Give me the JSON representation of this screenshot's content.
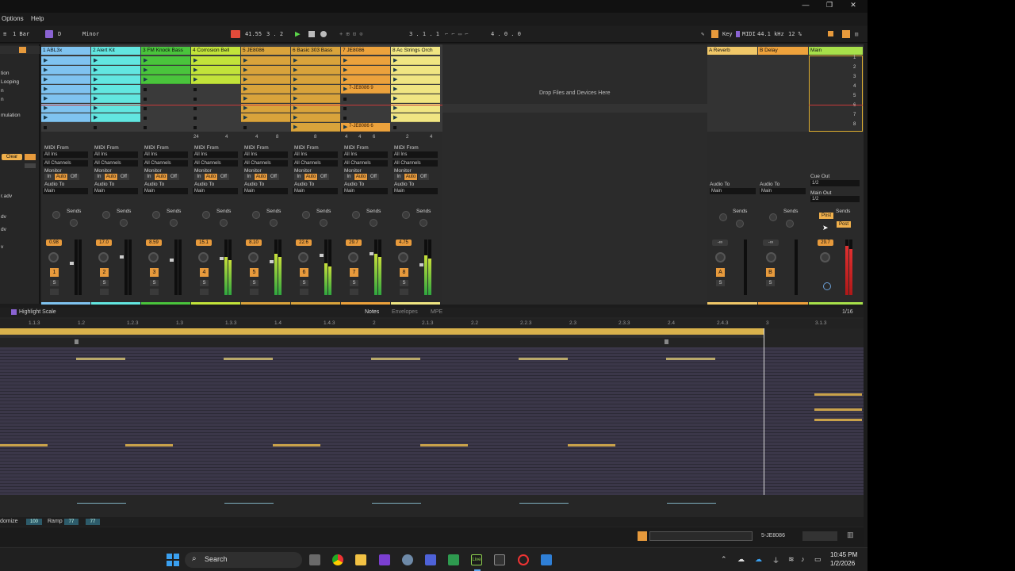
{
  "window": {
    "minimize": "—",
    "maximize": "❐",
    "close": "✕"
  },
  "menu": {
    "options": "Options",
    "help": "Help"
  },
  "control_bar": {
    "quantize": "1 Bar",
    "key_badge": "D",
    "scale": "Minor",
    "tempo": "41.55",
    "tempo_frac": "3 . 2",
    "pos_a": "3 . 1 . 1",
    "pos_b": "4 . 0 . 0",
    "key_label": "Key",
    "midi_label": "MIDI",
    "sample_rate": "44.1 kHz",
    "cpu": "12 %"
  },
  "left_panel": {
    "items": [
      "tion",
      "Looping",
      "n",
      "n",
      "mulation",
      "Clear",
      "r.adv",
      "dv",
      "dv",
      "v"
    ]
  },
  "tracks": [
    {
      "label": "1 ABL3x",
      "color": "#7fc3f0",
      "vol": "0.98",
      "num": "1"
    },
    {
      "label": "2 Alert Kit",
      "color": "#62e6e0",
      "vol": "17.0",
      "num": "2"
    },
    {
      "label": "3 FM Knock Bass",
      "color": "#4ac43c",
      "vol": "8.59",
      "num": "3"
    },
    {
      "label": "4 Corrosion Bell",
      "color": "#c2e33a",
      "vol": "15.1",
      "num": "4"
    },
    {
      "label": "5 JE8086",
      "color": "#d9a33b",
      "vol": "8.10",
      "num": "5"
    },
    {
      "label": "6 Basic 303 Bass",
      "color": "#d9a33b",
      "vol": "22.6",
      "num": "6"
    },
    {
      "label": "7 JE8086",
      "color": "#eca23c",
      "vol": "29.7",
      "num": "7"
    },
    {
      "label": "8 Ac Strings Orch",
      "color": "#f0e582",
      "vol": "4.75",
      "num": "8"
    }
  ],
  "returns": [
    {
      "label": "A Reverb",
      "color": "#f0c768",
      "num": "A",
      "vol": "-∞"
    },
    {
      "label": "B Delay",
      "color": "#eea23c",
      "num": "B",
      "vol": "-∞"
    },
    {
      "label": "Main",
      "color": "#a7e04a",
      "vol": "29.7"
    }
  ],
  "clips": {
    "je_a": "7-JE8086 9",
    "je_b": "7-JE8086 6"
  },
  "drop_text": "Drop Files and Devices Here",
  "io": {
    "midi_from": "MIDI From",
    "all_ins": "All Ins",
    "all_channels": "All Channels",
    "monitor": "Monitor",
    "in": "In",
    "auto": "Auto",
    "off": "Off",
    "audio_to": "Audio To",
    "main": "Main",
    "sends": "Sends",
    "cue_out": "Cue Out",
    "cue_val": "1/2",
    "main_out": "Main Out",
    "main_val": "1/2",
    "post": "Post",
    "s": "S",
    "a": "A",
    "b": "B",
    "scale_marks": [
      "0",
      "6",
      "12",
      "18",
      "24",
      "36",
      "48",
      "60"
    ]
  },
  "slot_counts": [
    "24",
    "4",
    "4",
    "8",
    "8",
    "4",
    "4",
    "6",
    "2",
    "4"
  ],
  "detail": {
    "highlight": "Highlight Scale",
    "tab_notes": "Notes",
    "tab_env": "Envelopes",
    "tab_mpe": "MPE",
    "grid": "1/16",
    "ticks": [
      "1.1.3",
      "1.2",
      "1.2.3",
      "1.3",
      "1.3.3",
      "1.4",
      "1.4.3",
      "2",
      "2.1.3",
      "2.2",
      "2.2.3",
      "2.3",
      "2.3.3",
      "2.4",
      "2.4.3",
      "3",
      "3.1.3"
    ],
    "randomize": "domize",
    "rand_val": "100",
    "ramp": "Ramp",
    "ramp_a": "77",
    "ramp_b": "77"
  },
  "status": {
    "track": "5-JE8086"
  },
  "taskbar": {
    "search": "Search",
    "time": "10:45 PM",
    "date": "1/2/2026"
  }
}
